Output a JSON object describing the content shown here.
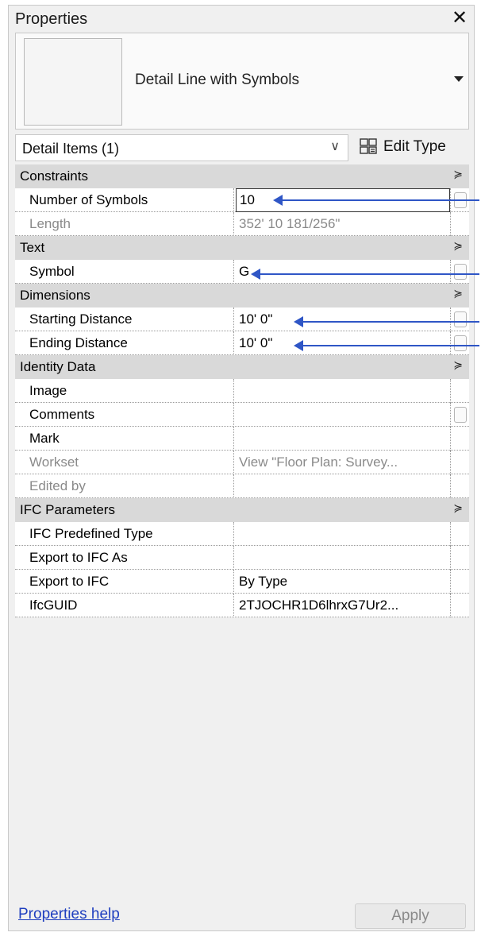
{
  "panel": {
    "title": "Properties",
    "close_glyph": "✕"
  },
  "type_selector": {
    "name": "Detail Line with Symbols"
  },
  "filter": {
    "value": "Detail Items (1)",
    "chevron": "∨"
  },
  "edit_type": {
    "label": "Edit Type"
  },
  "groups": [
    {
      "label": "Constraints",
      "collapse_glyph": "≽"
    },
    {
      "label": "Text",
      "collapse_glyph": "≽"
    },
    {
      "label": "Dimensions",
      "collapse_glyph": "≽"
    },
    {
      "label": "Identity Data",
      "collapse_glyph": "≽"
    },
    {
      "label": "IFC Parameters",
      "collapse_glyph": "≽"
    }
  ],
  "params": {
    "number_of_symbols": {
      "name": "Number of Symbols",
      "value": "10"
    },
    "length": {
      "name": "Length",
      "value": "352'  10 181/256\""
    },
    "symbol": {
      "name": "Symbol",
      "value": "G"
    },
    "starting_distance": {
      "name": "Starting Distance",
      "value": "10'  0\""
    },
    "ending_distance": {
      "name": "Ending Distance",
      "value": "10'  0\""
    },
    "image": {
      "name": "Image",
      "value": ""
    },
    "comments": {
      "name": "Comments",
      "value": ""
    },
    "mark": {
      "name": "Mark",
      "value": ""
    },
    "workset": {
      "name": "Workset",
      "value": "View \"Floor Plan: Survey..."
    },
    "edited_by": {
      "name": "Edited by",
      "value": ""
    },
    "ifc_predefined_type": {
      "name": "IFC Predefined Type",
      "value": ""
    },
    "export_to_ifc_as": {
      "name": "Export to IFC As",
      "value": ""
    },
    "export_to_ifc": {
      "name": "Export to IFC",
      "value": "By Type"
    },
    "ifcguid": {
      "name": "IfcGUID",
      "value": "2TJOCHR1D6lhrxG7Ur2..."
    }
  },
  "footer": {
    "help_link": "Properties help",
    "apply_label": "Apply"
  },
  "colors": {
    "annotation_arrow": "#2f56c6",
    "group_header_bg": "#d9d9d9",
    "link": "#1f3fbf"
  }
}
